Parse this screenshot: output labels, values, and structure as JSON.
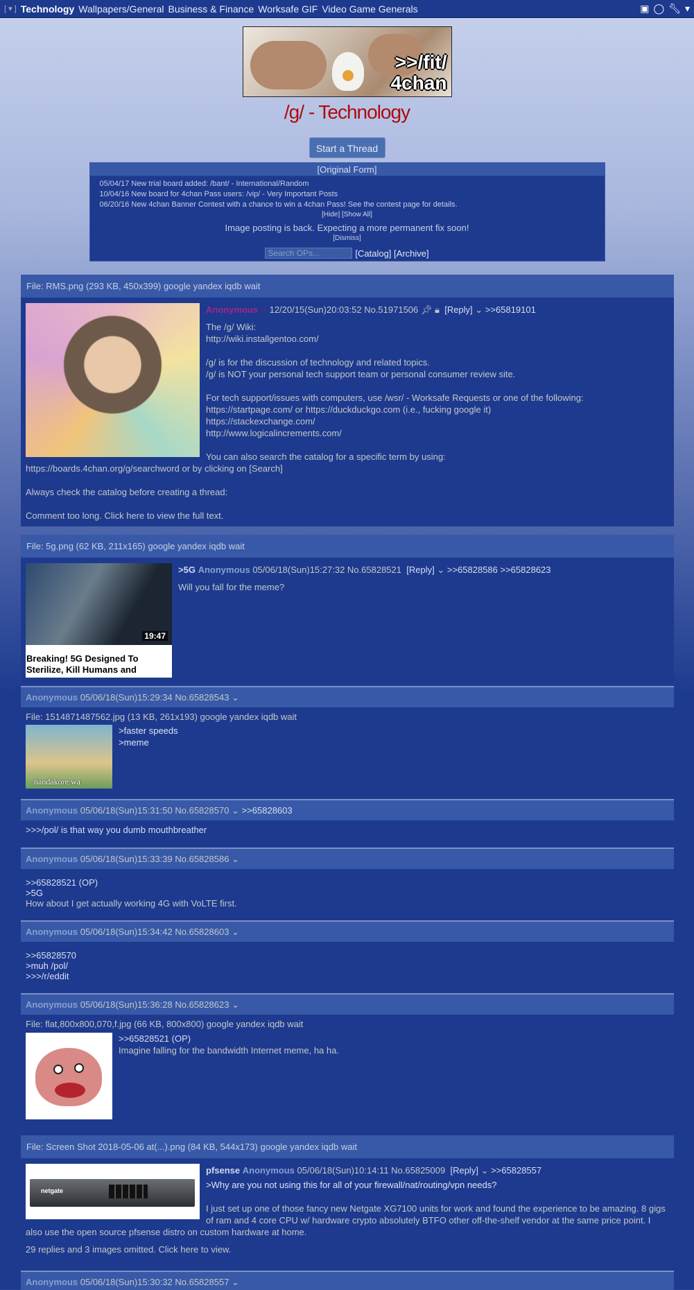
{
  "topbar": {
    "board_current": "Technology",
    "links": [
      "Wallpapers/General",
      "Business & Finance",
      "Worksafe GIF",
      "Video Game Generals"
    ]
  },
  "banner": {
    "line1": ">>/fit/",
    "line2": "4chan"
  },
  "board_title": "/g/ - Technology",
  "start_thread": "Start a Thread",
  "announce": {
    "original_form": "[Original Form]",
    "news": [
      "05/04/17 New trial board added: /bant/ - International/Random",
      "10/04/16 New board for 4chan Pass users: /vip/ - Very Important Posts",
      "06/20/16 New 4chan Banner Contest with a chance to win a 4chan Pass! See the contest page for details."
    ],
    "hide_show": "[Hide] [Show All]",
    "image_posting": "Image posting is back. Expecting a more permanent fix soon!",
    "dismiss": "[Dismiss]",
    "search_placeholder": "Search OPs...",
    "catalog_archive": "[Catalog] [Archive]"
  },
  "sticky": {
    "fileinfo": "File: RMS.png (293 KB, 450x399) google yandex iqdb wait",
    "name": "Anonymous",
    "datetime": "12/20/15(Sun)20:03:52 No.51971506",
    "reply": "[Reply]",
    "backlink": ">>65819101",
    "lines": [
      "The /g/ Wiki:",
      "http://wiki.installgentoo.com/",
      "",
      "/g/ is for the discussion of technology and related topics.",
      "/g/ is NOT your personal tech support team or personal consumer review site.",
      "",
      "For tech support/issues with computers, use /wsr/ - Worksafe Requests or one of the following:",
      "https://startpage.com/ or https://duckduckgo.com (i.e., fucking google it)",
      "https://stackexchange.com/",
      "http://www.logicalincrements.com/",
      "",
      "You can also search the catalog for a specific term by using:",
      "https://boards.4chan.org/g/searchword or by clicking on [Search]",
      "",
      "Always check the catalog before creating a thread:",
      "",
      "Comment too long. Click here to view the full text."
    ]
  },
  "thread1": {
    "fileinfo": "File: 5g.png (62 KB, 211x165) google yandex iqdb wait",
    "subject": ">5G",
    "name": "Anonymous",
    "datetime": "05/06/18(Sun)15:27:32 No.65828521",
    "reply": "[Reply]",
    "backlinks": ">>65828586 >>65828623",
    "message": "Will you fall for the meme?",
    "thumb_caption": "Breaking! 5G Designed To Sterilize, Kill Humans and",
    "thumb_duration": "19:47",
    "replies": [
      {
        "name": "Anonymous",
        "datetime": "05/06/18(Sun)15:29:34 No.65828543",
        "fileinfo": "File: 1514871487562.jpg (13 KB, 261x193) google yandex iqdb wait",
        "thumb_caption": "nandakore wa",
        "lines": [
          ">faster speeds",
          ">meme"
        ]
      },
      {
        "name": "Anonymous",
        "datetime": "05/06/18(Sun)15:31:50 No.65828570",
        "backlink": ">>65828603",
        "lines": [
          ">>>/pol/ is that way you dumb mouthbreather"
        ]
      },
      {
        "name": "Anonymous",
        "datetime": "05/06/18(Sun)15:33:39 No.65828586",
        "lines": [
          ">>65828521 (OP)",
          ">5G",
          "How about I get actually working 4G with VoLTE first."
        ]
      },
      {
        "name": "Anonymous",
        "datetime": "05/06/18(Sun)15:34:42 No.65828603",
        "lines": [
          ">>65828570",
          ">muh /pol/",
          ">>>/r/eddit"
        ]
      },
      {
        "name": "Anonymous",
        "datetime": "05/06/18(Sun)15:36:28 No.65828623",
        "fileinfo": "File: flat,800x800,070,f.jpg (66 KB, 800x800) google yandex iqdb wait",
        "lines": [
          ">>65828521 (OP)",
          "Imagine falling for the bandwidth Internet meme, ha ha."
        ]
      }
    ]
  },
  "thread2": {
    "fileinfo": "File: Screen Shot 2018-05-06 at(...).png (84 KB, 544x173) google yandex iqdb wait",
    "subject": "pfsense",
    "name": "Anonymous",
    "datetime": "05/06/18(Sun)10:14:11 No.65825009",
    "reply": "[Reply]",
    "backlink": ">>65828557",
    "headline": ">Why are you not using this for all of your firewall/nat/routing/vpn needs?",
    "message": "I just set up one of those fancy new Netgate XG7100 units for work and found the experience to be amazing. 8 gigs of ram and 4 core CPU w/ hardware crypto absolutely BTFO other off-the-shelf vendor at the same price point. I also use the open source pfsense distro on custom hardware at home.",
    "omitted": "29 replies and 3 images omitted. Click here to view.",
    "thumb_brand": "netgate",
    "last_reply": {
      "name": "Anonymous",
      "datetime": "05/06/18(Sun)15:30:32 No.65828557"
    }
  }
}
